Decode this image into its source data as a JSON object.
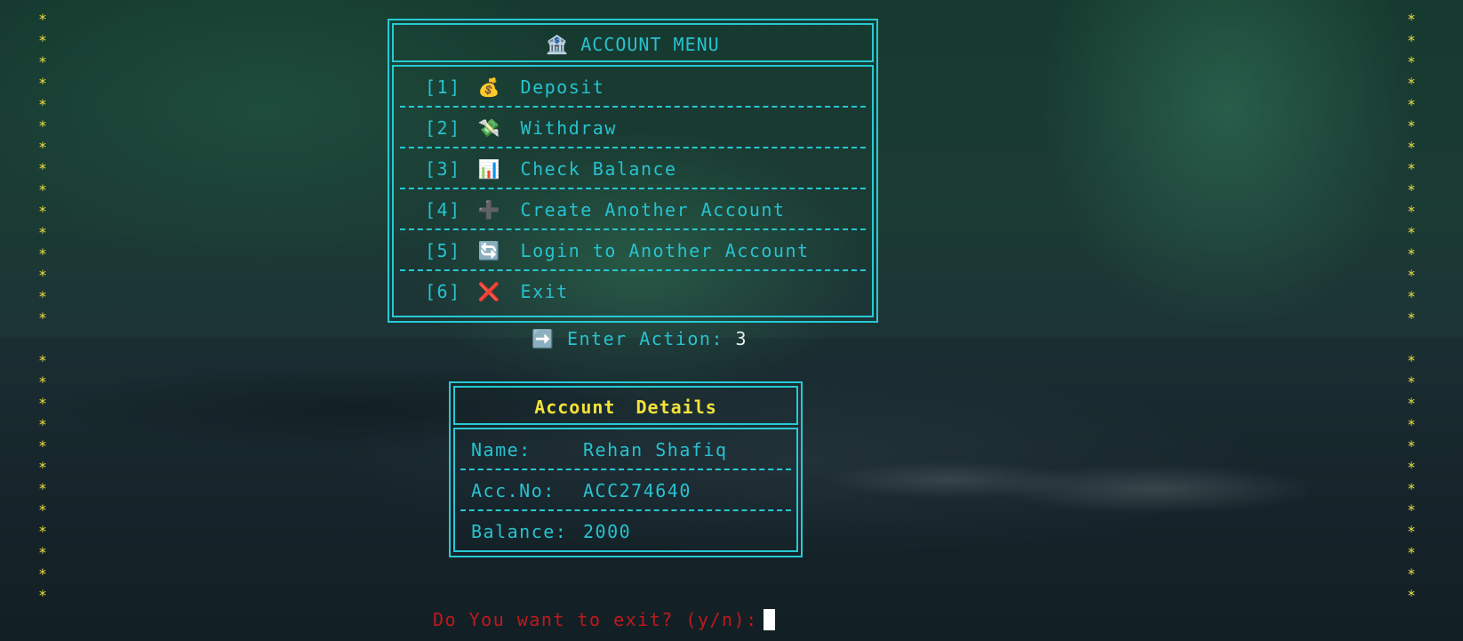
{
  "decor": {
    "star_glyph": "*",
    "star_color": "#f0e040"
  },
  "menu": {
    "title_icon": "🏦",
    "title": "ACCOUNT MENU",
    "items": [
      {
        "num": "[1]",
        "icon": "💰",
        "icon_name": "money-bag-icon",
        "label": "Deposit"
      },
      {
        "num": "[2]",
        "icon": "💸",
        "icon_name": "money-with-wings-icon",
        "label": "Withdraw"
      },
      {
        "num": "[3]",
        "icon": "📊",
        "icon_name": "bar-chart-icon",
        "label": "Check Balance"
      },
      {
        "num": "[4]",
        "icon": "➕",
        "icon_name": "plus-icon",
        "label": "Create Another Account"
      },
      {
        "num": "[5]",
        "icon": "🔄",
        "icon_name": "refresh-icon",
        "label": "Login to Another Account"
      },
      {
        "num": "[6]",
        "icon": "❌",
        "icon_name": "cross-icon",
        "label": "Exit"
      }
    ]
  },
  "action_prompt": {
    "icon": "➡️",
    "label": "Enter Action:",
    "value": "3"
  },
  "details": {
    "title": "Account Details",
    "rows": [
      {
        "key": "Name:",
        "value": "Rehan Shafiq"
      },
      {
        "key": "Acc.No:",
        "value": "ACC274640"
      },
      {
        "key": "Balance:",
        "value": "2000"
      }
    ]
  },
  "exit_prompt": {
    "label": "Do You want to exit? (y/n):",
    "value": ""
  },
  "colors": {
    "cyan": "#27c2cf",
    "border": "#26c9d4",
    "yellow": "#f3e23a",
    "red": "#c0191c"
  }
}
